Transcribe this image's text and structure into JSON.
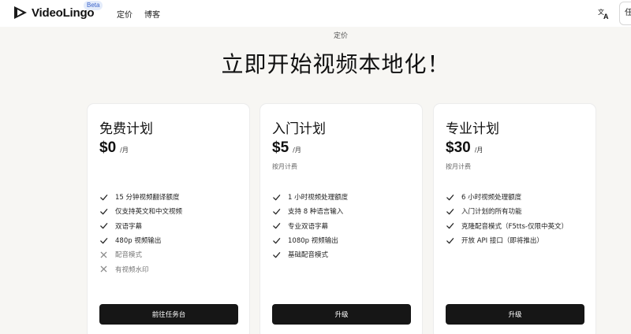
{
  "header": {
    "brand": "VideoLingo",
    "beta": "Beta",
    "nav": [
      {
        "label": "定价"
      },
      {
        "label": "博客"
      }
    ],
    "language_button": "任"
  },
  "hero": {
    "eyebrow": "定价",
    "title": "立即开始视频本地化！"
  },
  "plans": [
    {
      "name": "免费计划",
      "price": "$0",
      "period": "/月",
      "billing": "",
      "features": [
        {
          "text": "15 分钟视频翻译额度",
          "included": true
        },
        {
          "text": "仅支持英文和中文视频",
          "included": true
        },
        {
          "text": "双语字幕",
          "included": true
        },
        {
          "text": "480p 视频输出",
          "included": true
        },
        {
          "text": "配音模式",
          "included": false
        },
        {
          "text": "有视频水印",
          "included": false
        }
      ],
      "cta": "前往任务台"
    },
    {
      "name": "入门计划",
      "price": "$5",
      "period": "/月",
      "billing": "按月计费",
      "features": [
        {
          "text": "1 小时视频处理额度",
          "included": true
        },
        {
          "text": "支持 8 种语言输入",
          "included": true
        },
        {
          "text": "专业双语字幕",
          "included": true
        },
        {
          "text": "1080p 视频输出",
          "included": true
        },
        {
          "text": "基础配音模式",
          "included": true
        }
      ],
      "cta": "升级"
    },
    {
      "name": "专业计划",
      "price": "$30",
      "period": "/月",
      "billing": "按月计费",
      "features": [
        {
          "text": "6 小时视频处理额度",
          "included": true
        },
        {
          "text": "入门计划的所有功能",
          "included": true
        },
        {
          "text": "克隆配音模式（F5tts-仅限中英文）",
          "included": true
        },
        {
          "text": "开放 API 接口（即将推出）",
          "included": true
        }
      ],
      "cta": "升级"
    }
  ]
}
